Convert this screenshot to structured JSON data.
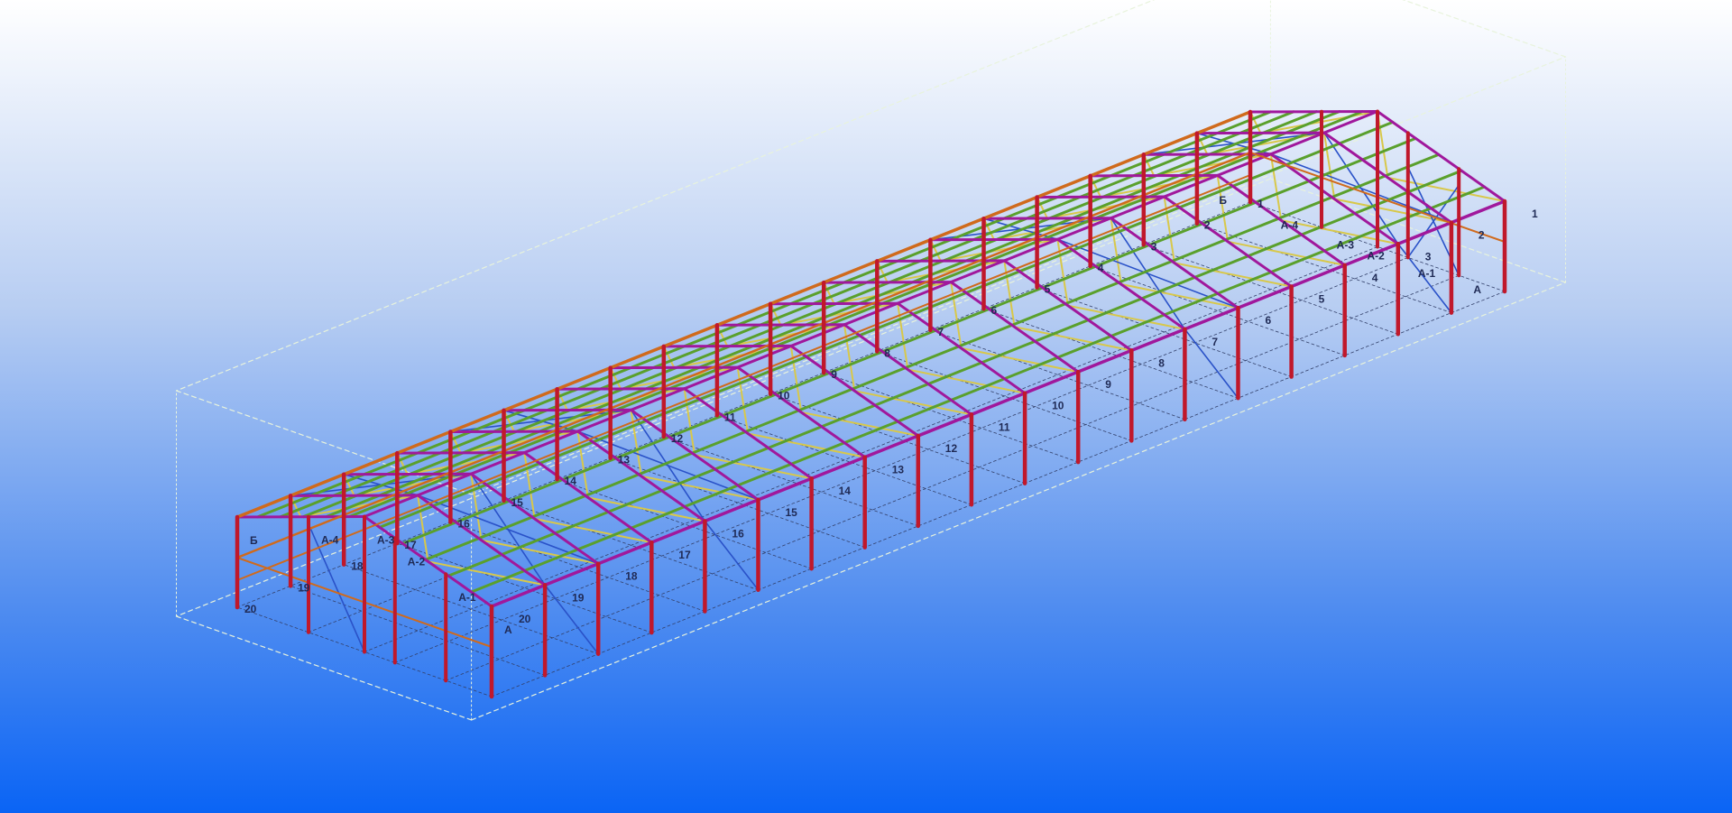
{
  "model": {
    "grid_numbers_near": [
      "1",
      "2",
      "3",
      "4",
      "5",
      "6",
      "7",
      "8",
      "9",
      "10",
      "11",
      "12",
      "13",
      "14",
      "15",
      "16",
      "17",
      "18",
      "19",
      "20"
    ],
    "grid_numbers_far": [
      "1",
      "2",
      "3",
      "4",
      "5",
      "6",
      "7",
      "8",
      "9",
      "10",
      "11",
      "12",
      "13",
      "14",
      "15",
      "16",
      "17",
      "18",
      "19",
      "20"
    ],
    "grid_letters_front": [
      "А",
      "А-1",
      "А-2",
      "А-3",
      "А-4",
      "Б"
    ],
    "grid_letters_back": [
      "А",
      "А-1",
      "А-2",
      "А-3",
      "А-4",
      "Б"
    ]
  },
  "colors": {
    "column": "#c0182b",
    "ridge_beam": "#a0189c",
    "purlin": "#5aa02c",
    "brace_yellow": "#d8c84a",
    "brace_blue": "#2a52c8",
    "eave_beam": "#d06a1c",
    "bounding_box": "#e8f3dc",
    "label": "#1f2a55"
  }
}
